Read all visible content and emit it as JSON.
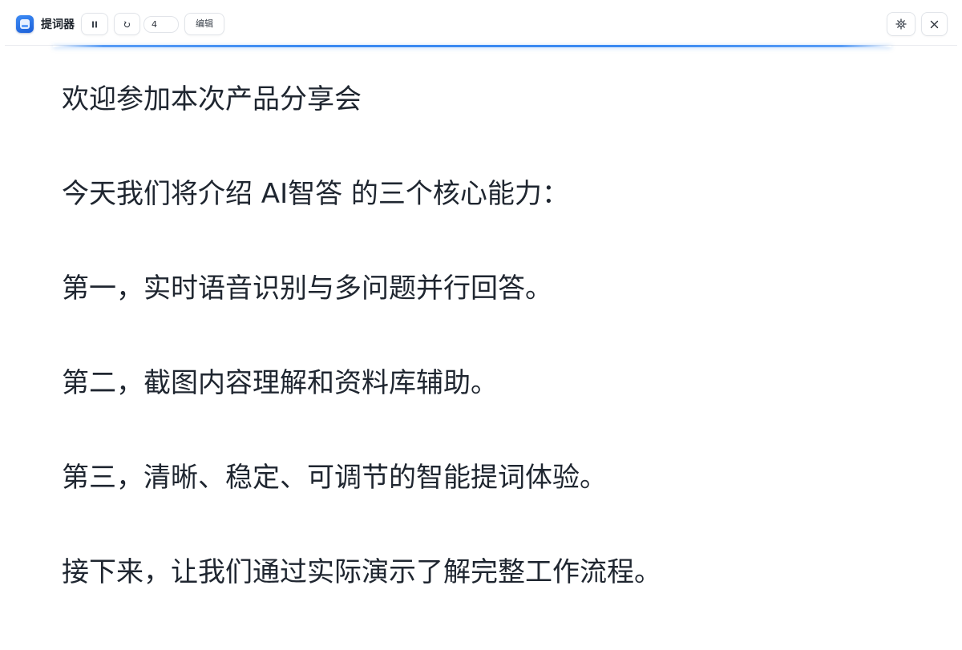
{
  "app": {
    "title": "提词器"
  },
  "toolbar": {
    "pause_icon": "pause-icon",
    "restart_icon": "restart-icon",
    "speed_value": "4",
    "edit_label": "编辑",
    "settings_icon": "gear-icon",
    "close_icon": "close-icon"
  },
  "colors": {
    "accent": "#3a8af2",
    "text": "#1f2630",
    "border": "#e1e4e9"
  },
  "script": {
    "lines": [
      "欢迎参加本次产品分享会",
      "今天我们将介绍 AI智答 的三个核心能力：",
      "第一，实时语音识别与多问题并行回答。",
      "第二，截图内容理解和资料库辅助。",
      "第三，清晰、稳定、可调节的智能提词体验。",
      "接下来，让我们通过实际演示了解完整工作流程。"
    ]
  }
}
